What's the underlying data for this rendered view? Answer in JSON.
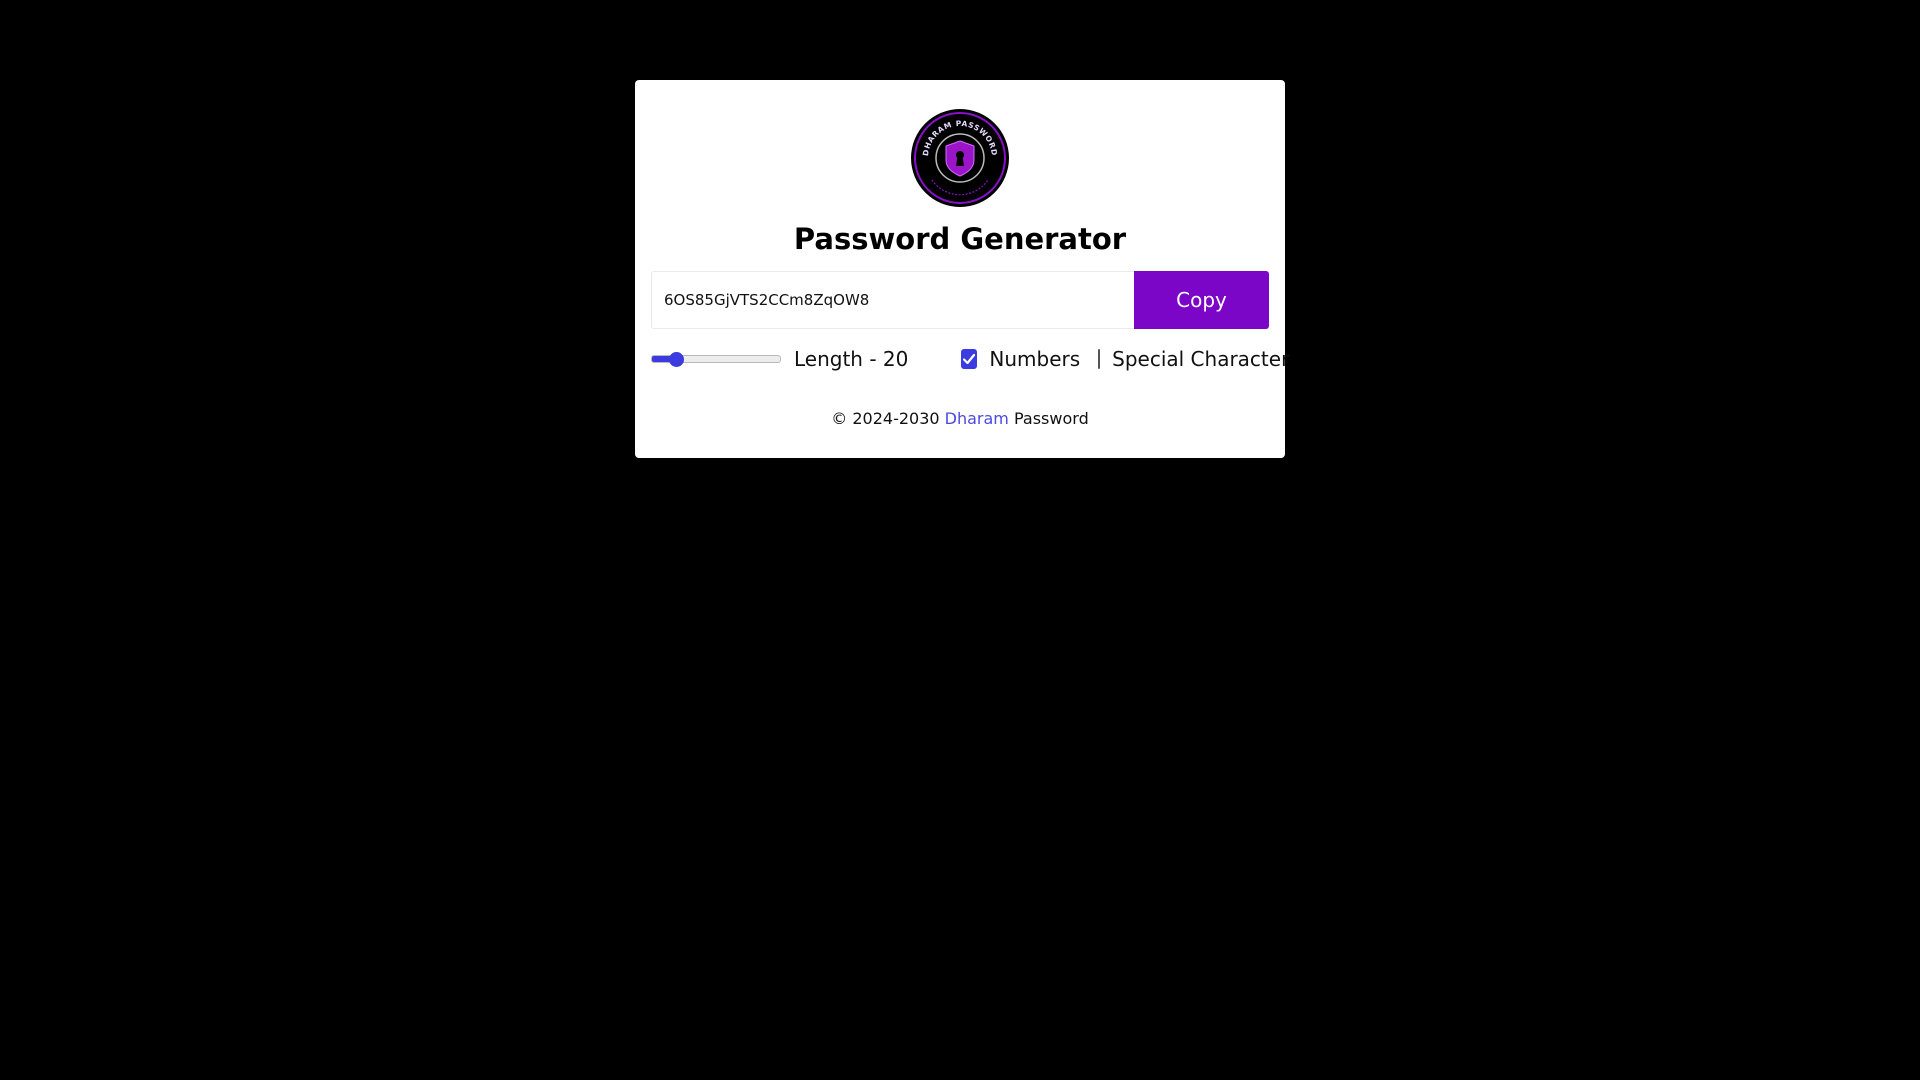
{
  "app": {
    "title": "Password Generator"
  },
  "logo": {
    "ring_text": "DHARAM PASSWORD",
    "icon": "shield-keyhole-icon",
    "colors": {
      "outer": "#000000",
      "ring": "#8a10c8",
      "shield": "#9a14c8"
    }
  },
  "password": {
    "value": "6OS85GjVTS2CCm8ZqOW8"
  },
  "copy_button": {
    "label": "Copy",
    "color": "#7b06c8"
  },
  "options": {
    "length": {
      "label": "Length - 20",
      "value": 20,
      "min": 6,
      "max": 100
    },
    "numbers": {
      "label": "Numbers",
      "checked": true
    },
    "special_character": {
      "label": "Special Character",
      "checked": false
    },
    "accent_color": "#3b3be0"
  },
  "footer": {
    "prefix": "© 2024-2030",
    "link": "Dharam",
    "suffix": "Password",
    "link_color": "#4a4ae0"
  },
  "colors": {
    "background": "#000000",
    "card": "#ffffff"
  }
}
